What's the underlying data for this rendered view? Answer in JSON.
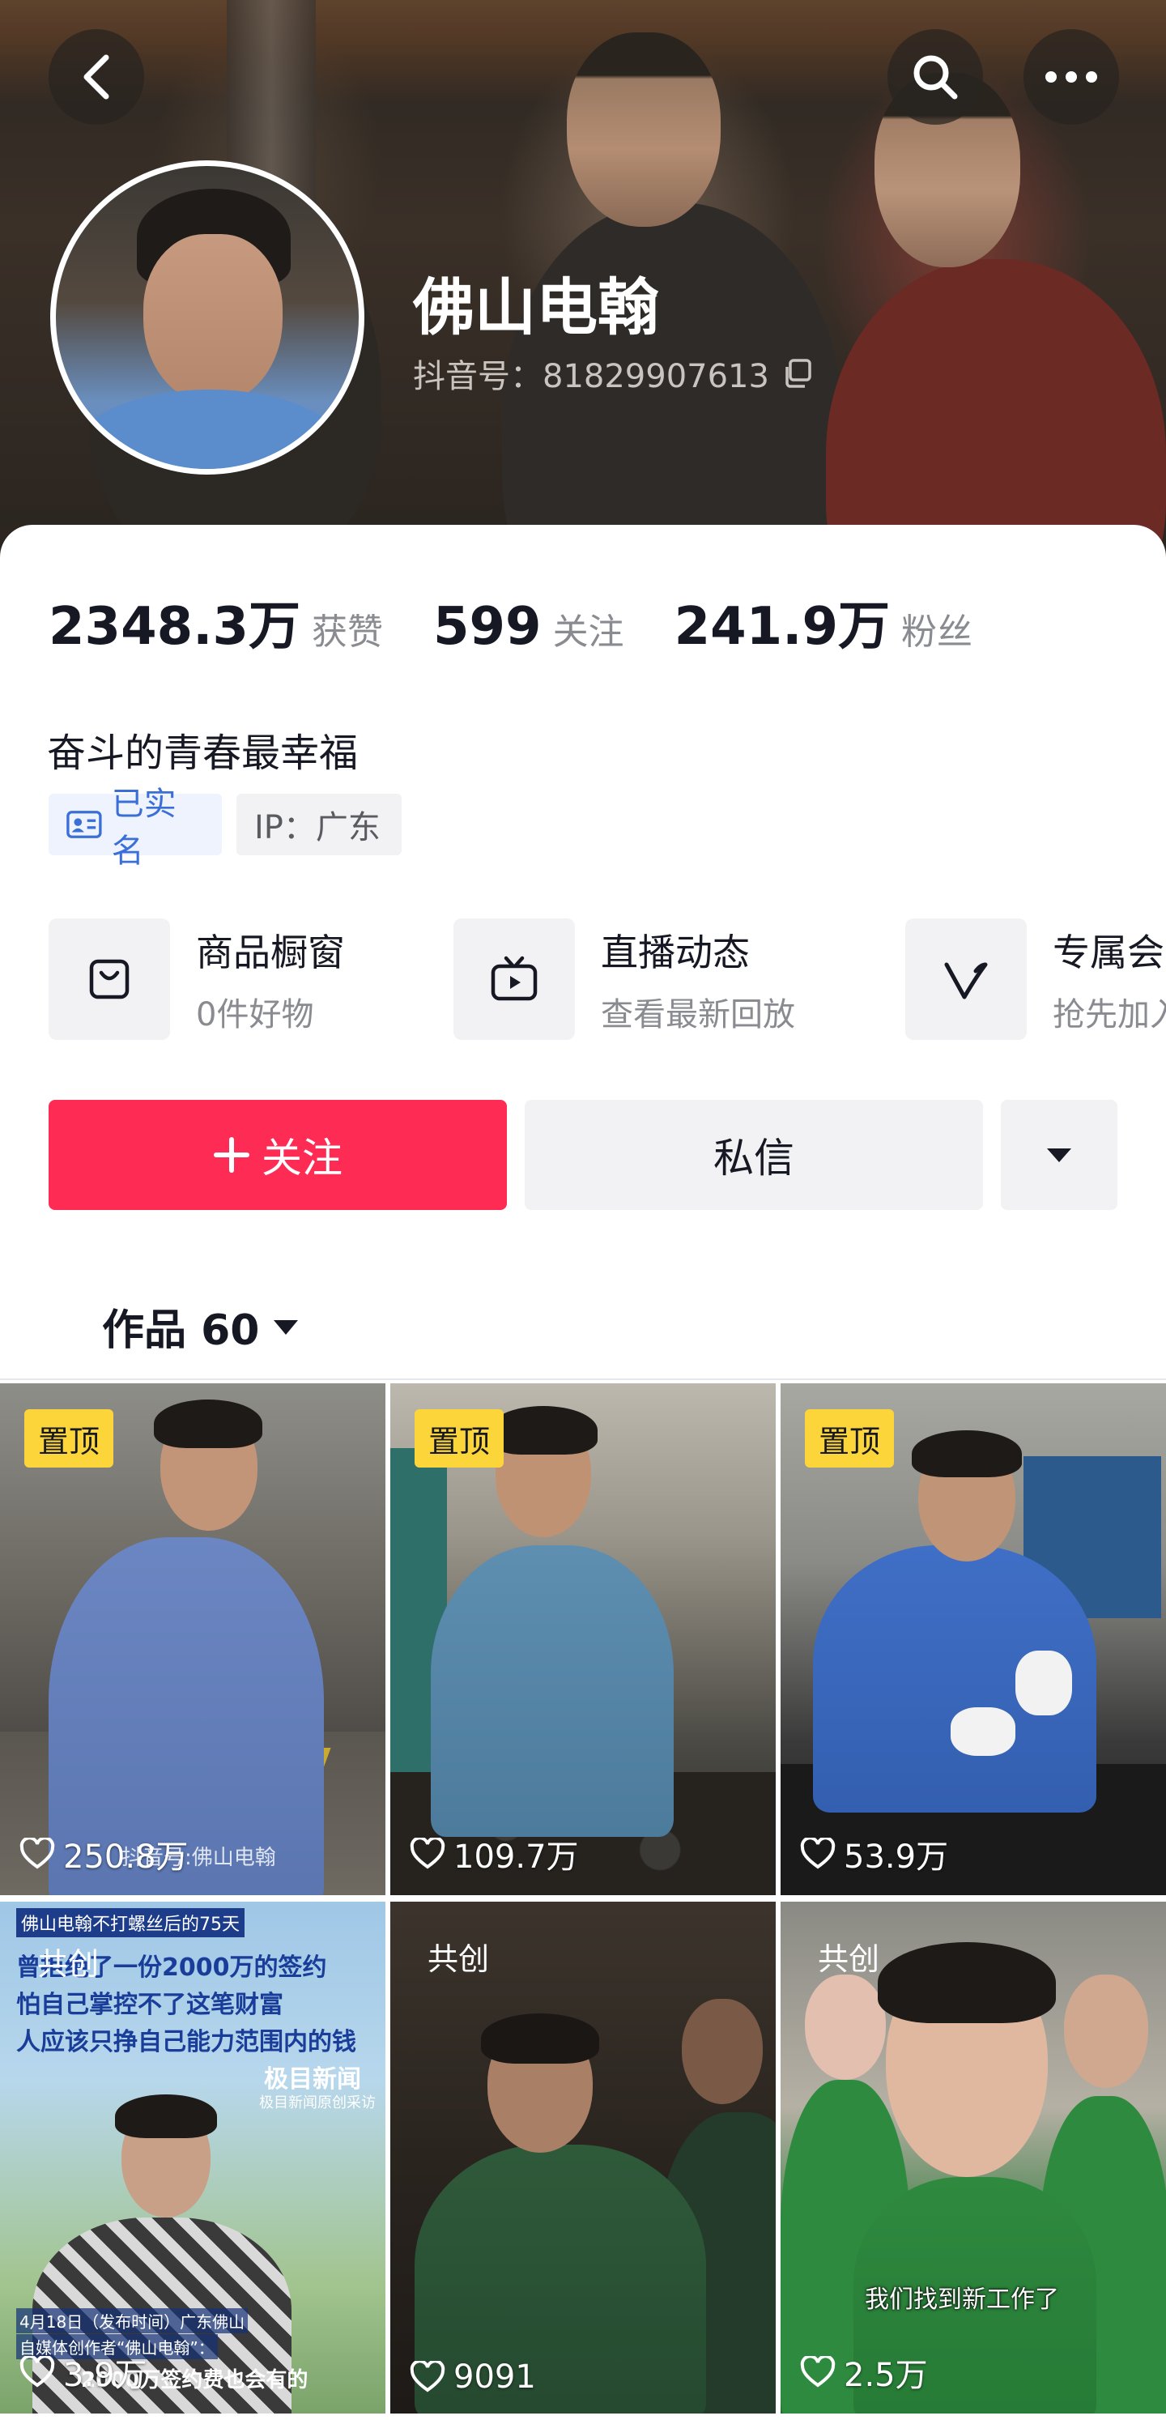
{
  "profile": {
    "nickname": "佛山电翰",
    "douyin_id": "抖音号：81829907613"
  },
  "stats": {
    "likes_value": "2348.3万",
    "likes_label": "获赞",
    "following_value": "599",
    "following_label": "关注",
    "followers_value": "241.9万",
    "followers_label": "粉丝"
  },
  "bio": "奋斗的青春最幸福",
  "tags": {
    "verified": "已实名",
    "ip": "IP：广东"
  },
  "services": [
    {
      "title": "商品橱窗",
      "subtitle": "0件好物",
      "icon": "bag-icon"
    },
    {
      "title": "直播动态",
      "subtitle": "查看最新回放",
      "icon": "tv-icon"
    },
    {
      "title": "专属会",
      "subtitle": "抢先加入",
      "icon": "v-icon"
    }
  ],
  "actions": {
    "follow": "关注",
    "message": "私信"
  },
  "tab": {
    "label": "作品 60"
  },
  "videos": [
    {
      "badge": "置顶",
      "likes": "250.8万",
      "watermark": "抖音号:佛山电翰"
    },
    {
      "badge": "置顶",
      "likes": "109.7万"
    },
    {
      "badge": "置顶",
      "likes": "53.9万"
    },
    {
      "badge": "共创",
      "likes": "3.9万",
      "top_caption": "佛山电翰不打螺丝后的75天",
      "headline_1": "曾拒绝了一份2000万的签约",
      "headline_2": "怕自己掌控不了这笔财富",
      "headline_3": "人应该只挣自己能力范围内的钱",
      "news_brand": "极目新闻",
      "news_sub": "极目新闻原创采访",
      "bottom_caption_1": "4月18日（发布时间）广东佛山",
      "bottom_caption_2": "自媒体创作者“佛山电翰”：",
      "bottom_caption_3": "2000万签约费也会有的"
    },
    {
      "badge": "共创",
      "likes": "9091"
    },
    {
      "badge": "共创",
      "likes": "2.5万",
      "subtitle": "我们找到新工作了"
    }
  ],
  "colors": {
    "follow_button": "#fe2c55",
    "pin_badge": "#fcd53a",
    "verified_blue": "#3b6fd8"
  }
}
